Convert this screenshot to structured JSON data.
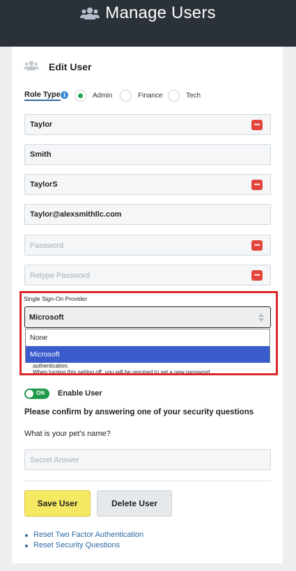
{
  "page": {
    "title": "Manage Users"
  },
  "card": {
    "title": "Edit User"
  },
  "role": {
    "label": "Role Type",
    "options": [
      "Admin",
      "Finance",
      "Tech"
    ],
    "selected": "Admin"
  },
  "fields": {
    "first_name": {
      "value": "Taylor"
    },
    "last_name": {
      "value": "Smith"
    },
    "username": {
      "value": "TaylorS"
    },
    "email": {
      "value": "Taylor@alexsmithllc.com"
    },
    "password": {
      "placeholder": "Password"
    },
    "retype_password": {
      "placeholder": "Retype Password"
    }
  },
  "sso": {
    "label": "Single Sign-On Provider",
    "value": "Microsoft",
    "options": [
      "None",
      "Microsoft"
    ],
    "help_line1": "authentication.",
    "help_line2": "When turning this setting off, you will be required to set a new password."
  },
  "enable": {
    "toggle_text": "ON",
    "label": "Enable User"
  },
  "security": {
    "confirm_text": "Please confirm by answering one of your security questions",
    "question": "What is your pet's name?",
    "answer_placeholder": "Secret Answer"
  },
  "buttons": {
    "save": "Save User",
    "delete": "Delete User"
  },
  "links": [
    "Reset Two Factor Authentication",
    "Reset Security Questions"
  ],
  "colors": {
    "header_bg": "#2a3138",
    "accent_green": "#22a653",
    "save_yellow": "#f5e862",
    "selected_blue": "#3a5ccc",
    "highlight_red": "#dc2626"
  }
}
